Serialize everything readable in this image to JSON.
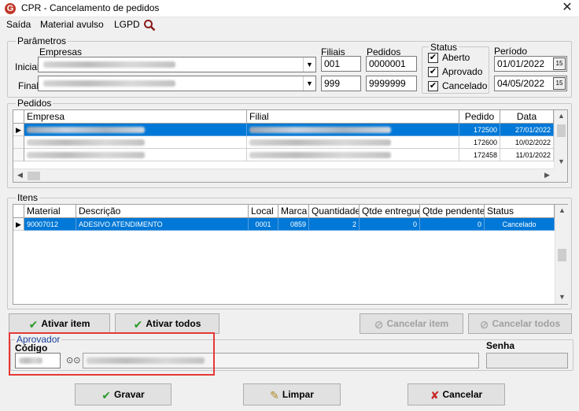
{
  "window": {
    "title": "CPR - Cancelamento de pedidos",
    "app_icon_letter": "G"
  },
  "menu": {
    "items": [
      "Saída",
      "Material avulso",
      "LGPD"
    ]
  },
  "parametros": {
    "legend": "Parâmetros",
    "empresas_label": "Empresas",
    "filiais_label": "Filiais",
    "pedidos_label": "Pedidos",
    "inicial_label": "Inicial",
    "final_label": "Final",
    "filial_inicial": "001",
    "filial_final": "999",
    "pedido_inicial": "0000001",
    "pedido_final": "9999999",
    "status": {
      "legend": "Status",
      "aberto": "Aberto",
      "aprovado": "Aprovado",
      "cancelado": "Cancelado"
    },
    "periodo_label": "Período",
    "data_inicial": "01/01/2022",
    "data_final": "04/05/2022"
  },
  "pedidos": {
    "legend": "Pedidos",
    "columns": [
      "Empresa",
      "Filial",
      "Pedido",
      "Data"
    ],
    "rows": [
      {
        "pedido": "172500",
        "data": "27/01/2022",
        "selected": true
      },
      {
        "pedido": "172600",
        "data": "10/02/2022",
        "selected": false
      },
      {
        "pedido": "172458",
        "data": "11/01/2022",
        "selected": false
      }
    ]
  },
  "itens": {
    "legend": "Itens",
    "columns": [
      "Material",
      "Descrição",
      "Local",
      "Marca",
      "Quantidade",
      "Qtde entregue",
      "Qtde pendente",
      "Status"
    ],
    "rows": [
      {
        "material": "90007012",
        "descricao": "ADESIVO ATENDIMENTO",
        "local": "0001",
        "marca": "0859",
        "quantidade": "2",
        "entregue": "0",
        "pendente": "0",
        "status": "Cancelado"
      }
    ]
  },
  "actions": {
    "ativar_item": "Ativar item",
    "ativar_todos": "Ativar todos",
    "cancelar_item": "Cancelar item",
    "cancelar_todos": "Cancelar todos"
  },
  "aprovador": {
    "legend": "Aprovador",
    "codigo_label": "Código",
    "senha_label": "Senha"
  },
  "footer": {
    "gravar": "Gravar",
    "limpar": "Limpar",
    "cancelar": "Cancelar"
  },
  "colors": {
    "selection": "#0078d7",
    "highlight": "#e53935",
    "ok_green": "#2a9a2a",
    "cancel_red": "#c8282a"
  }
}
